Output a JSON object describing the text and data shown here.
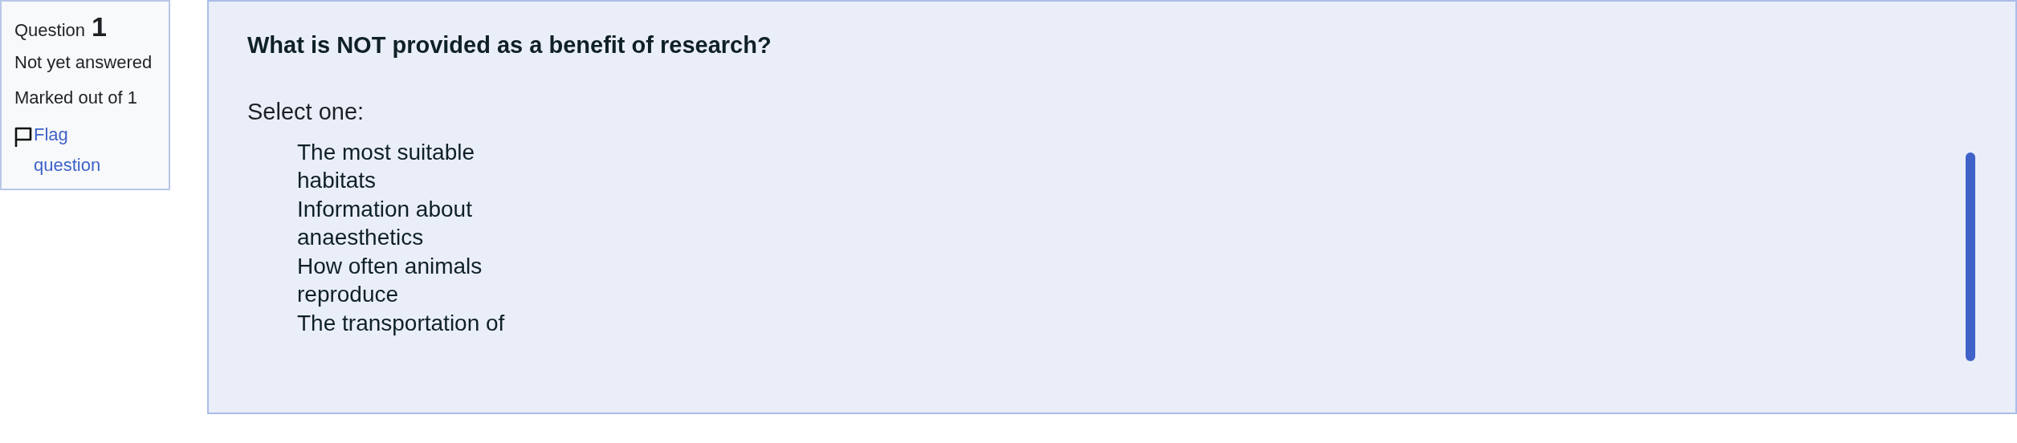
{
  "info": {
    "label": "Question",
    "number": "1",
    "status": "Not yet answered",
    "mark": "Marked out of 1",
    "flag_link": "Flag question"
  },
  "question": {
    "text": "What is NOT provided as a benefit of research?",
    "prompt": "Select one:",
    "options": [
      {
        "text": "The most suitable habitats"
      },
      {
        "text": "Information about anaesthetics"
      },
      {
        "text": "How often animals reproduce"
      },
      {
        "text": "The transportation of"
      }
    ]
  }
}
